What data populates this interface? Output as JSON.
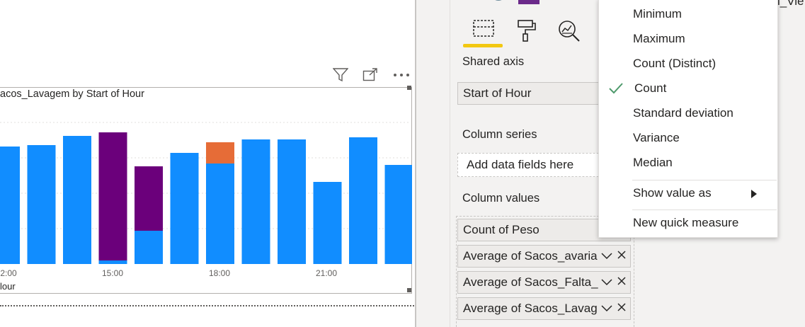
{
  "visual": {
    "title": "acos_Lavagem by Start of Hour"
  },
  "chart_data": {
    "type": "bar",
    "x_tick_labels": [
      "2:00",
      "15:00",
      "18:00",
      "21:00"
    ],
    "xlabel": "lour",
    "series": [
      {
        "color": "#118dff",
        "values": [
          166,
          168,
          181,
          5,
          47,
          157,
          142,
          176,
          176,
          116,
          179,
          140
        ]
      },
      {
        "color": "#6b007b",
        "values": [
          0,
          0,
          0,
          181,
          91,
          0,
          0,
          0,
          0,
          0,
          0,
          0
        ]
      },
      {
        "color": "#e66c37",
        "values": [
          0,
          0,
          0,
          0,
          0,
          0,
          30,
          0,
          0,
          0,
          0,
          0
        ]
      }
    ],
    "grid": true
  },
  "fields_pane": {
    "shared_axis_label": "Shared axis",
    "shared_axis_field": "Start of Hour",
    "column_series_label": "Column series",
    "column_series_placeholder": "Add data fields here",
    "column_values_label": "Column values",
    "column_values": [
      "Count of Peso",
      "Average of Sacos_avaria",
      "Average of Sacos_Falta_",
      "Average of Sacos_Lavag"
    ]
  },
  "context_menu": {
    "items": [
      "Minimum",
      "Maximum",
      "Count (Distinct)",
      "Count",
      "Standard deviation",
      "Variance",
      "Median"
    ],
    "checked": "Count",
    "show_value_as": "Show value as",
    "new_quick_measure": "New quick measure"
  },
  "top_right_text": "l_Vie",
  "colors": {
    "accent_yellow": "#f2c811",
    "check_green": "#4e9a6c"
  }
}
